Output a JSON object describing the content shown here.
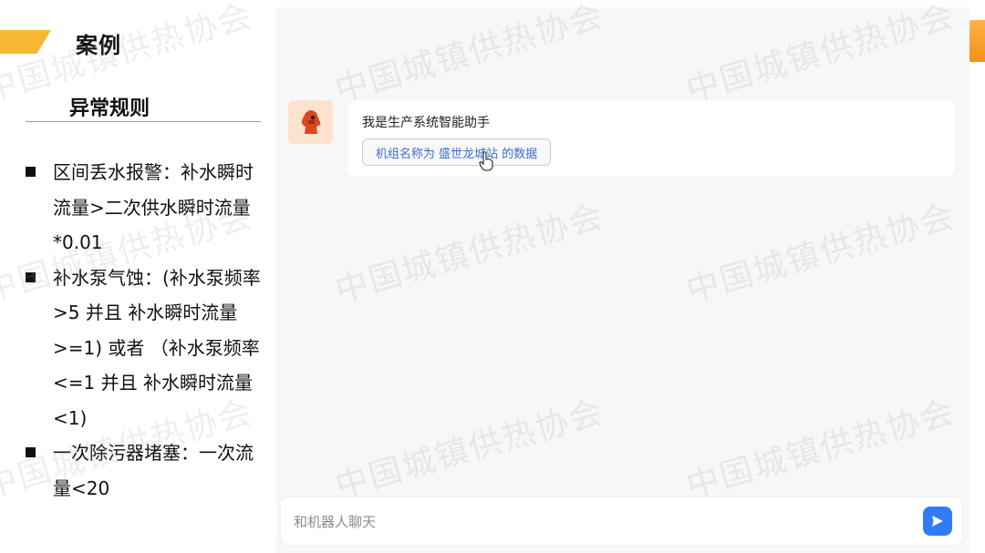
{
  "slide": {
    "case_title": "案例",
    "section_title": "异常规则",
    "rules": [
      "区间丢水报警：补水瞬时流量>二次供水瞬时流量*0.01",
      "补水泵气蚀：(补水泵频率>5 并且 补水瞬时流量>=1) 或者 （补水泵频率<=1 并且 补水瞬时流量<1)",
      "一次除污器堵塞：一次流量<20"
    ]
  },
  "chat": {
    "bot_message": "我是生产系统智能助手",
    "suggestion": "机组名称为 盛世龙城站 的数据",
    "input_placeholder": "和机器人聊天"
  },
  "watermark": "中国城镇供热协会",
  "icons": {
    "avatar": "robot-avatar-icon",
    "cursor": "hand-pointer-icon",
    "send": "send-icon"
  },
  "colors": {
    "accent": "#f7b733",
    "send_button": "#2f7cf6",
    "chip_text": "#3f6ec9"
  }
}
